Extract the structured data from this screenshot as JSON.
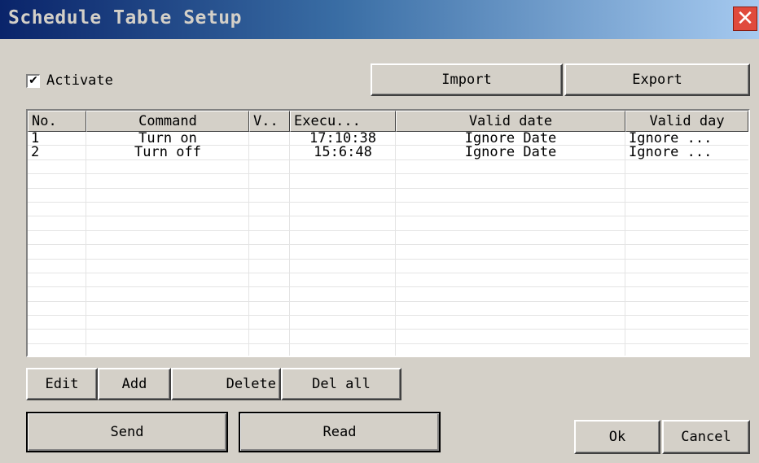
{
  "window": {
    "title": "Schedule Table Setup"
  },
  "activate": {
    "label": "Activate",
    "checked": true
  },
  "toolbar": {
    "import_label": "Import",
    "export_label": "Export"
  },
  "table": {
    "columns": [
      "No.",
      "Command",
      "V..",
      "Execu...",
      "Valid date",
      "Valid day"
    ],
    "rows": [
      [
        "1",
        "Turn on",
        "",
        "17:10:38",
        "Ignore Date",
        "Ignore ..."
      ],
      [
        "2",
        "Turn off",
        "",
        "15:6:48",
        "Ignore Date",
        "Ignore ..."
      ]
    ],
    "empty_rows": 14
  },
  "actions": {
    "edit": "Edit",
    "add": "Add",
    "delete": "Delete",
    "del_all": "Del all"
  },
  "bottom": {
    "send": "Send",
    "read": "Read",
    "ok": "Ok",
    "cancel": "Cancel"
  }
}
